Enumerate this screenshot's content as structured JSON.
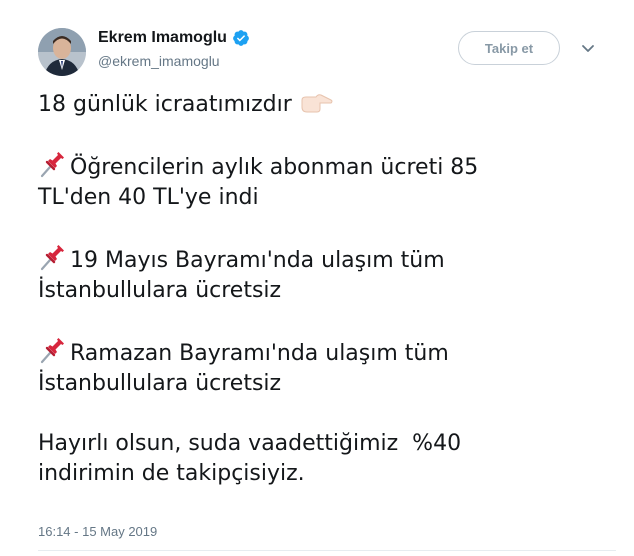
{
  "author": {
    "name": "Ekrem Imamoglu",
    "handle": "@ekrem_imamoglu",
    "verified": true
  },
  "follow_button": {
    "label": "Takip et"
  },
  "icons": {
    "verified": "verified-badge-icon",
    "caret": "chevron-down-icon",
    "pin": "pushpin-icon",
    "point": "pointing-right-icon"
  },
  "colors": {
    "verified_blue": "#1da1f2",
    "pin_red": "#d7263d",
    "muted_text": "#657786"
  },
  "tweet": {
    "line_intro": "18 günlük icraatımızdır",
    "item1": {
      "line1": "Öğrencilerin aylık abonman ücreti 85",
      "line2": "TL'den 40 TL'ye indi"
    },
    "item2": {
      "line1": "19 Mayıs Bayramı'nda ulaşım tüm",
      "line2": "İstanbullulara ücretsiz"
    },
    "item3": {
      "line1": "Ramazan Bayramı'nda ulaşım tüm",
      "line2": "İstanbullulara ücretsiz"
    },
    "closing": {
      "line1": "Hayırlı olsun, suda vaadettiğimiz  %40",
      "line2": "indirimin de takipçisiyiz."
    }
  },
  "timestamp": "16:14 - 15 May 2019"
}
